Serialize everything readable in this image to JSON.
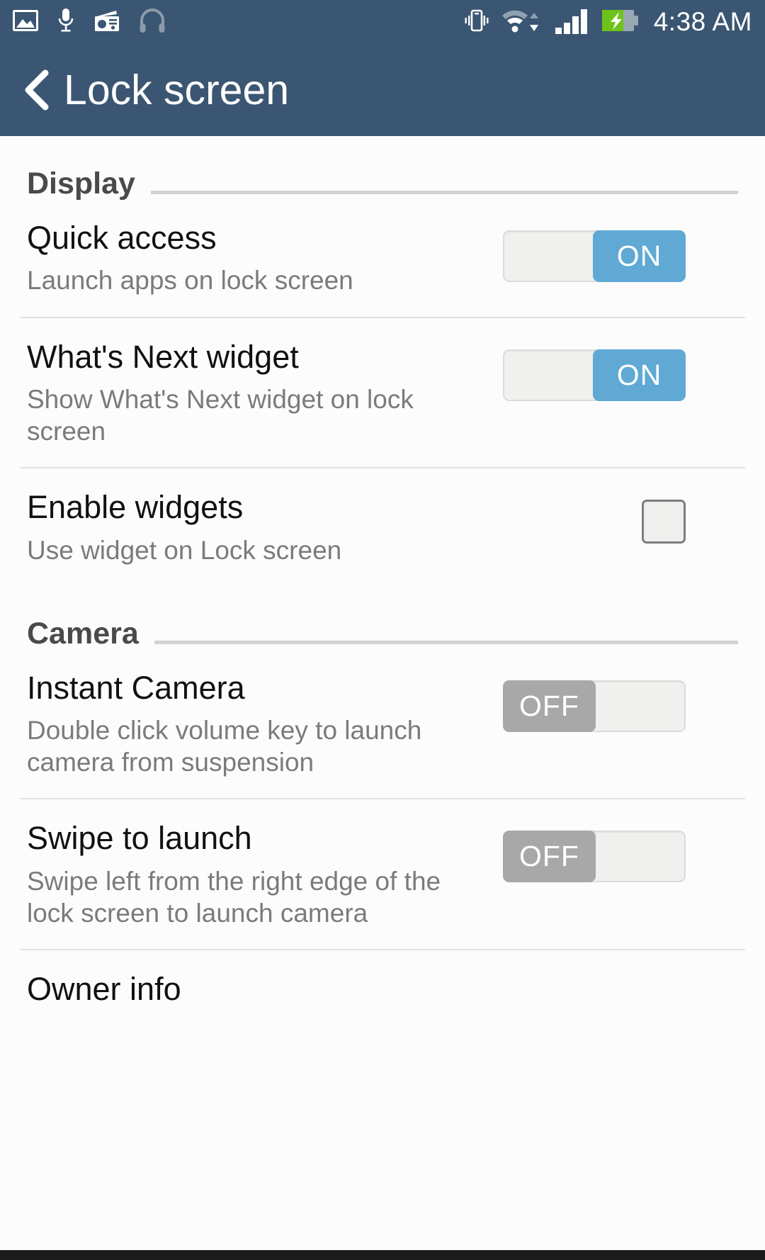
{
  "statusbar": {
    "left_icons": [
      {
        "name": "image-icon"
      },
      {
        "name": "microphone-icon"
      },
      {
        "name": "radio-icon"
      },
      {
        "name": "headphones-icon"
      }
    ],
    "right_icons": [
      {
        "name": "vibrate-icon"
      },
      {
        "name": "wifi-icon"
      },
      {
        "name": "signal-bars-icon"
      },
      {
        "name": "battery-charging-icon"
      }
    ],
    "time": "4:38 AM",
    "bar_color": "#3b5672"
  },
  "header": {
    "back_label": "back",
    "title": "Lock screen"
  },
  "sections": [
    {
      "title": "Display",
      "rows": [
        {
          "title": "Quick access",
          "subtitle": "Launch apps on lock screen",
          "control": "toggle",
          "state": "ON"
        },
        {
          "title": "What's Next widget",
          "subtitle": "Show What's Next widget on lock screen",
          "control": "toggle",
          "state": "ON"
        },
        {
          "title": "Enable widgets",
          "subtitle": "Use widget on Lock screen",
          "control": "checkbox",
          "state": "unchecked"
        }
      ]
    },
    {
      "title": "Camera",
      "rows": [
        {
          "title": "Instant Camera",
          "subtitle": "Double click volume key to launch camera from suspension",
          "control": "toggle",
          "state": "OFF"
        },
        {
          "title": "Swipe to launch",
          "subtitle": "Swipe left from the right edge of the lock screen to launch camera",
          "control": "toggle",
          "state": "OFF"
        },
        {
          "title": "Owner info",
          "subtitle": "",
          "control": "none",
          "state": ""
        }
      ]
    }
  ],
  "colors": {
    "accent_on": "#5fa9d4",
    "accent_off": "#a8a8a8",
    "header_bg": "#3b5672",
    "battery_green": "#6ec21a"
  }
}
